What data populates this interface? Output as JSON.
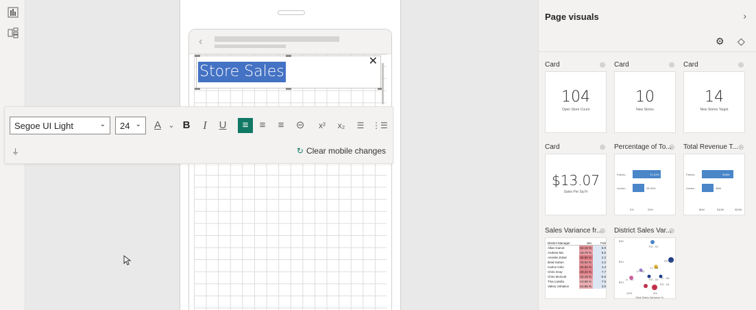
{
  "rail": {
    "icons": [
      "report-view-icon",
      "mobile-layout-icon"
    ]
  },
  "textbox": {
    "title": "Store Sales",
    "close": "✕"
  },
  "toolbar": {
    "font": "Segoe UI Light",
    "size": "24",
    "buttons": [
      {
        "name": "font-color-button",
        "label": "A"
      },
      {
        "name": "font-color-dropdown",
        "label": "⌄"
      },
      {
        "name": "bold-button",
        "label": "B"
      },
      {
        "name": "italic-button",
        "label": "I"
      },
      {
        "name": "underline-button",
        "label": "U"
      },
      {
        "name": "align-left-button",
        "label": "≡"
      },
      {
        "name": "align-center-button",
        "label": "≡"
      },
      {
        "name": "align-right-button",
        "label": "≡"
      },
      {
        "name": "link-button",
        "label": "⊝"
      },
      {
        "name": "superscript-button",
        "label": "x²"
      },
      {
        "name": "subscript-button",
        "label": "x₂"
      },
      {
        "name": "bullets-button",
        "label": "☰"
      },
      {
        "name": "numbered-list-button",
        "label": "⋮☰"
      }
    ],
    "clear_label": "Clear mobile changes"
  },
  "pane": {
    "title": "Page visuals",
    "visuals": [
      {
        "title": "Card",
        "kind": "card",
        "value": "104",
        "label": "Open Store Count"
      },
      {
        "title": "Card",
        "kind": "card",
        "value": "10",
        "label": "New Stores"
      },
      {
        "title": "Card",
        "kind": "card",
        "value": "14",
        "label": "New Stores Target"
      },
      {
        "title": "Card",
        "kind": "card",
        "value": "$13.07",
        "label": "Sales Per Sq Ft"
      },
      {
        "title": "Percentage of To...",
        "kind": "bar"
      },
      {
        "title": "Total Revenue T...",
        "kind": "bar"
      },
      {
        "title": "Sales Variance fr...",
        "kind": "table"
      },
      {
        "title": "District Sales Var...",
        "kind": "scatter"
      }
    ]
  },
  "chart_data": [
    {
      "type": "bar",
      "categories": [
        "Fashio...",
        "Lindse..."
      ],
      "values": [
        71.01,
        28.99
      ],
      "value_labels": [
        "71.01%",
        "28.99%"
      ],
      "xticks": [
        "0%",
        "50%"
      ],
      "xlim": [
        0,
        100
      ]
    },
    {
      "type": "bar",
      "categories": [
        "Fashio...",
        "Lindse..."
      ],
      "values": [
        16,
        6
      ],
      "value_labels": [
        "$16M",
        "$6M"
      ],
      "xticks": [
        "$0M",
        "$10M",
        "$20M"
      ],
      "xlim": [
        0,
        20
      ]
    },
    {
      "type": "table",
      "columns": [
        "District Manager",
        "Jan",
        "Feb"
      ],
      "rows": [
        [
          "Allan Guinot",
          "-24.15 %",
          "6.9"
        ],
        [
          "Andrew Ma",
          "-18.78 %",
          "5.5"
        ],
        [
          "Annelie Zubar",
          "-30.80 %",
          "2.2"
        ],
        [
          "Brad Sutton",
          "-23.02 %",
          "4.2"
        ],
        [
          "Carlos Grilo",
          "-26.60 %",
          "4.3"
        ],
        [
          "Chris Gray",
          "-28.22 %",
          "7.7"
        ],
        [
          "Chris McGurk",
          "-22.19 %",
          "-0.8"
        ],
        [
          "Tina Lassila",
          "-13.58 %",
          "7.6"
        ],
        [
          "Valery Ushakov",
          "-14.86 %",
          "3.0"
        ]
      ]
    },
    {
      "type": "scatter",
      "xlabel": "Total Sales Variance %",
      "ylabel": "Sales Per Sq Ft",
      "yticks": [
        "$15",
        "$14",
        "$13"
      ],
      "xticks": [
        "-10%",
        "0%"
      ],
      "point_labels": [
        "FD - 01",
        "FD - 02",
        "LI - 03",
        "LI - 02",
        "LI - 05",
        "FD - 03",
        "FD - 04",
        "LI - 01"
      ]
    }
  ]
}
